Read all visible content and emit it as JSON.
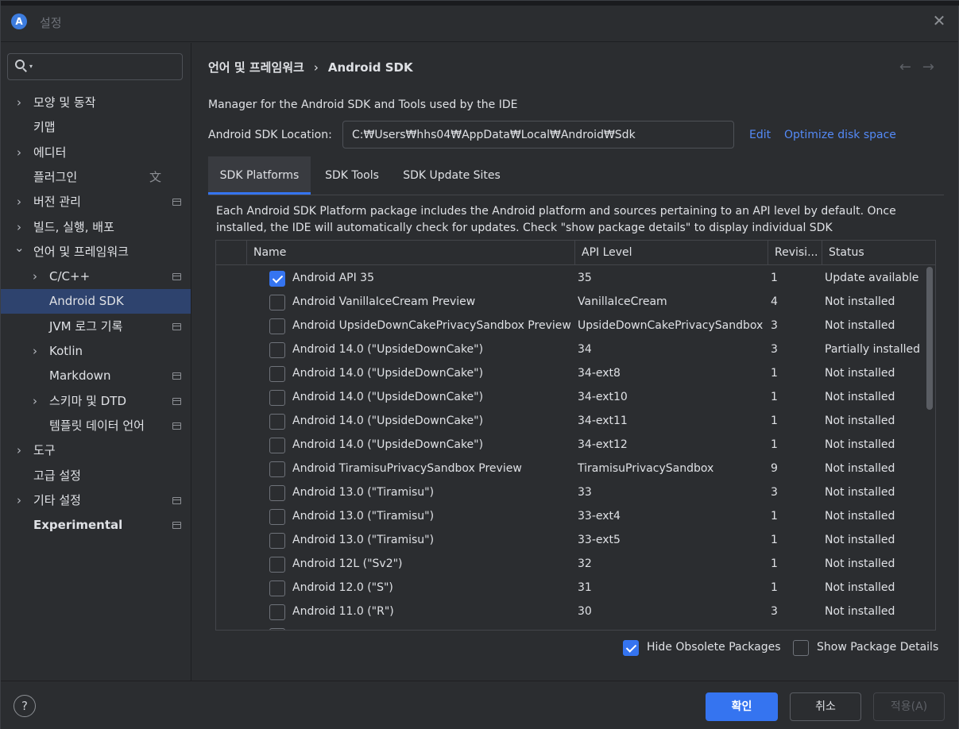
{
  "window": {
    "title": "설정",
    "app_icon": "android-studio-icon"
  },
  "search": {
    "value": "",
    "placeholder": ""
  },
  "sidebar": {
    "items": [
      {
        "label": "모양 및 동작",
        "expandable": true,
        "bold": false,
        "project": false
      },
      {
        "label": "키맵",
        "expandable": false,
        "bold": false,
        "project": false
      },
      {
        "label": "에디터",
        "expandable": true,
        "bold": false,
        "project": false
      },
      {
        "label": "플러그인",
        "expandable": false,
        "bold": false,
        "project": false,
        "translate_icon": true
      },
      {
        "label": "버전 관리",
        "expandable": true,
        "bold": false,
        "project": true
      },
      {
        "label": "빌드, 실행, 배포",
        "expandable": true,
        "bold": false,
        "project": false
      },
      {
        "label": "언어 및 프레임워크",
        "expandable": true,
        "expanded": true,
        "bold": false,
        "project": false
      },
      {
        "label": "C/C++",
        "expandable": true,
        "indent": 1,
        "bold": false,
        "project": true
      },
      {
        "label": "Android SDK",
        "expandable": false,
        "indent": 1,
        "selected": true,
        "bold": false,
        "project": false
      },
      {
        "label": "JVM 로그 기록",
        "expandable": false,
        "indent": 1,
        "bold": false,
        "project": true
      },
      {
        "label": "Kotlin",
        "expandable": true,
        "indent": 1,
        "bold": false,
        "project": false
      },
      {
        "label": "Markdown",
        "expandable": false,
        "indent": 1,
        "bold": false,
        "project": true
      },
      {
        "label": "스키마 및 DTD",
        "expandable": true,
        "indent": 1,
        "bold": false,
        "project": true
      },
      {
        "label": "템플릿 데이터 언어",
        "expandable": false,
        "indent": 1,
        "bold": false,
        "project": true
      },
      {
        "label": "도구",
        "expandable": true,
        "bold": false,
        "project": false
      },
      {
        "label": "고급 설정",
        "expandable": false,
        "bold": false,
        "project": false
      },
      {
        "label": "기타 설정",
        "expandable": true,
        "bold": false,
        "project": true
      },
      {
        "label": "Experimental",
        "expandable": false,
        "bold": true,
        "project": true
      }
    ]
  },
  "breadcrumb": {
    "parent": "언어 및 프레임워크",
    "separator": "›",
    "current": "Android SDK"
  },
  "nav": {
    "back": "←",
    "forward": "→"
  },
  "main": {
    "description": "Manager for the Android SDK and Tools used by the IDE",
    "location_label": "Android SDK Location:",
    "location_value": "C:₩Users₩hhs04₩AppData₩Local₩Android₩Sdk",
    "edit_link": "Edit",
    "optimize_link": "Optimize disk space",
    "tabs": [
      "SDK Platforms",
      "SDK Tools",
      "SDK Update Sites"
    ],
    "active_tab": 0,
    "info": "Each Android SDK Platform package includes the Android platform and sources pertaining to an API level by default. Once installed, the IDE will automatically check for updates. Check \"show package details\" to display individual SDK components."
  },
  "table": {
    "columns": [
      "Name",
      "API Level",
      "Revisi...",
      "Status"
    ],
    "rows": [
      {
        "checked": true,
        "name": "Android API 35",
        "api": "35",
        "rev": "1",
        "status": "Update available"
      },
      {
        "checked": false,
        "name": "Android VanillaIceCream Preview",
        "api": "VanillaIceCream",
        "rev": "4",
        "status": "Not installed"
      },
      {
        "checked": false,
        "name": "Android UpsideDownCakePrivacySandbox Preview",
        "api": "UpsideDownCakePrivacySandbox",
        "rev": "3",
        "status": "Not installed"
      },
      {
        "checked": false,
        "name": "Android 14.0 (\"UpsideDownCake\")",
        "api": "34",
        "rev": "3",
        "status": "Partially installed"
      },
      {
        "checked": false,
        "name": "Android 14.0 (\"UpsideDownCake\")",
        "api": "34-ext8",
        "rev": "1",
        "status": "Not installed"
      },
      {
        "checked": false,
        "name": "Android 14.0 (\"UpsideDownCake\")",
        "api": "34-ext10",
        "rev": "1",
        "status": "Not installed"
      },
      {
        "checked": false,
        "name": "Android 14.0 (\"UpsideDownCake\")",
        "api": "34-ext11",
        "rev": "1",
        "status": "Not installed"
      },
      {
        "checked": false,
        "name": "Android 14.0 (\"UpsideDownCake\")",
        "api": "34-ext12",
        "rev": "1",
        "status": "Not installed"
      },
      {
        "checked": false,
        "name": "Android TiramisuPrivacySandbox Preview",
        "api": "TiramisuPrivacySandbox",
        "rev": "9",
        "status": "Not installed"
      },
      {
        "checked": false,
        "name": "Android 13.0 (\"Tiramisu\")",
        "api": "33",
        "rev": "3",
        "status": "Not installed"
      },
      {
        "checked": false,
        "name": "Android 13.0 (\"Tiramisu\")",
        "api": "33-ext4",
        "rev": "1",
        "status": "Not installed"
      },
      {
        "checked": false,
        "name": "Android 13.0 (\"Tiramisu\")",
        "api": "33-ext5",
        "rev": "1",
        "status": "Not installed"
      },
      {
        "checked": false,
        "name": "Android 12L (\"Sv2\")",
        "api": "32",
        "rev": "1",
        "status": "Not installed"
      },
      {
        "checked": false,
        "name": "Android 12.0 (\"S\")",
        "api": "31",
        "rev": "1",
        "status": "Not installed"
      },
      {
        "checked": false,
        "name": "Android 11.0 (\"R\")",
        "api": "30",
        "rev": "3",
        "status": "Not installed"
      }
    ]
  },
  "options": {
    "hide_obsolete": {
      "label": "Hide Obsolete Packages",
      "checked": true
    },
    "show_details": {
      "label": "Show Package Details",
      "checked": false
    }
  },
  "footer": {
    "help": "?",
    "ok": "확인",
    "cancel": "취소",
    "apply": "적용(A)"
  },
  "colors": {
    "accent": "#3574f0",
    "link": "#548af7",
    "selection": "#2e436e",
    "background": "#2b2d30"
  }
}
